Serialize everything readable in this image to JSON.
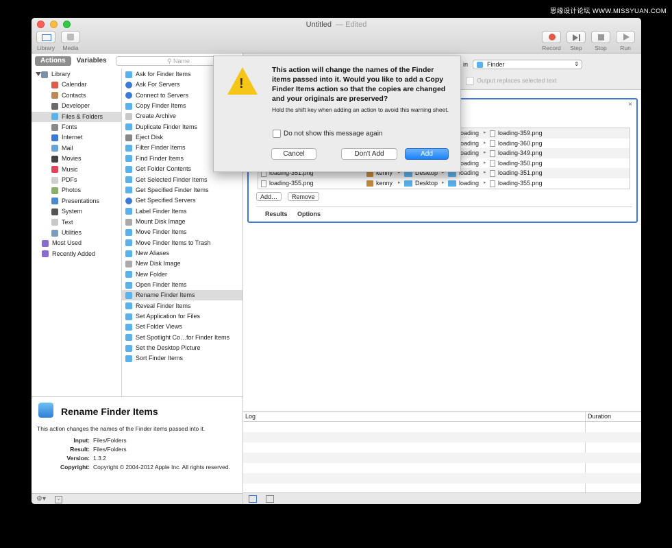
{
  "watermark": "思缘设计论坛 WWW.MISSYUAN.COM",
  "window": {
    "title": "Untitled",
    "separator": "—",
    "status": "Edited"
  },
  "toolbar": {
    "left": [
      {
        "label": "Library",
        "icon": "library-icon"
      },
      {
        "label": "Media",
        "icon": "media-icon"
      }
    ],
    "right": [
      {
        "label": "Record",
        "icon": "record-icon"
      },
      {
        "label": "Step",
        "icon": "step-icon"
      },
      {
        "label": "Stop",
        "icon": "stop-icon"
      },
      {
        "label": "Run",
        "icon": "run-icon"
      }
    ]
  },
  "library": {
    "tabs": [
      "Actions",
      "Variables"
    ],
    "search_placeholder": "Name",
    "categories": [
      {
        "label": "Library",
        "color": "#7b8fa8"
      },
      {
        "label": "Calendar",
        "color": "#e05a4a"
      },
      {
        "label": "Contacts",
        "color": "#b88c5a"
      },
      {
        "label": "Developer",
        "color": "#6a6a6a"
      },
      {
        "label": "Files & Folders",
        "color": "#5ab2ec"
      },
      {
        "label": "Fonts",
        "color": "#8a8a8a"
      },
      {
        "label": "Internet",
        "color": "#3a7bd5"
      },
      {
        "label": "Mail",
        "color": "#6aa3d8"
      },
      {
        "label": "Movies",
        "color": "#444444"
      },
      {
        "label": "Music",
        "color": "#e0445a"
      },
      {
        "label": "PDFs",
        "color": "#d0d0d0"
      },
      {
        "label": "Photos",
        "color": "#8ab06a"
      },
      {
        "label": "Presentations",
        "color": "#4a8ad0"
      },
      {
        "label": "System",
        "color": "#555555"
      },
      {
        "label": "Text",
        "color": "#c8c8c8"
      },
      {
        "label": "Utilities",
        "color": "#7a9ac0"
      },
      {
        "label": "Most Used",
        "color": "#8a6ad0"
      },
      {
        "label": "Recently Added",
        "color": "#8a6ad0"
      }
    ],
    "actions": [
      "Ask for Finder Items",
      "Ask For Servers",
      "Connect to Servers",
      "Copy Finder Items",
      "Create Archive",
      "Duplicate Finder Items",
      "Eject Disk",
      "Filter Finder Items",
      "Find Finder Items",
      "Get Folder Contents",
      "Get Selected Finder Items",
      "Get Specified Finder Items",
      "Get Specified Servers",
      "Label Finder Items",
      "Mount Disk Image",
      "Move Finder Items",
      "Move Finder Items to Trash",
      "New Aliases",
      "New Disk Image",
      "New Folder",
      "Open Finder Items",
      "Rename Finder Items",
      "Reveal Finder Items",
      "Set Application for Files",
      "Set Folder Views",
      "Set Spotlight Co…for Finder Items",
      "Set the Desktop Picture",
      "Sort Finder Items"
    ]
  },
  "description": {
    "title": "Rename Finder Items",
    "text": "This action changes the names of the Finder items passed into it.",
    "rows": [
      {
        "k": "Input:",
        "v": "Files/Folders"
      },
      {
        "k": "Result:",
        "v": "Files/Folders"
      },
      {
        "k": "Version:",
        "v": "1.3.2"
      },
      {
        "k": "Copyright:",
        "v": "Copyright © 2004-2012 Apple Inc.  All rights reserved."
      }
    ]
  },
  "workflow_bar": {
    "in_label": "in",
    "app": "Finder",
    "output_option": "Output replaces selected text"
  },
  "action_card": {
    "rows": [
      {
        "name": "",
        "user": "",
        "desk": "",
        "fold": "loading",
        "file": "loading-359.png"
      },
      {
        "name": "",
        "user": "",
        "desk": "",
        "fold": "loading",
        "file": "loading-360.png"
      },
      {
        "name": "",
        "user": "",
        "desk": "",
        "fold": "loading",
        "file": "loading-349.png"
      },
      {
        "name": "",
        "user": "",
        "desk": "",
        "fold": "loading",
        "file": "loading-350.png"
      },
      {
        "name": "loading-351.png",
        "user": "kenny",
        "desk": "Desktop",
        "fold": "loading",
        "file": "loading-351.png"
      },
      {
        "name": "loading-355.png",
        "user": "kenny",
        "desk": "Desktop",
        "fold": "loading",
        "file": "loading-355.png"
      }
    ],
    "add_button": "Add…",
    "remove_button": "Remove",
    "tabs": [
      "Results",
      "Options"
    ]
  },
  "log": {
    "col_log": "Log",
    "col_duration": "Duration"
  },
  "sheet": {
    "message": "This action will change the names of the Finder items passed into it.  Would you like to add a Copy Finder Items action so that the copies are changed and your originals are preserved?",
    "info": "Hold the shift key when adding an action to avoid this warning sheet.",
    "checkbox": "Do not show this message again",
    "buttons": {
      "cancel": "Cancel",
      "dont_add": "Don't Add",
      "add": "Add"
    }
  }
}
